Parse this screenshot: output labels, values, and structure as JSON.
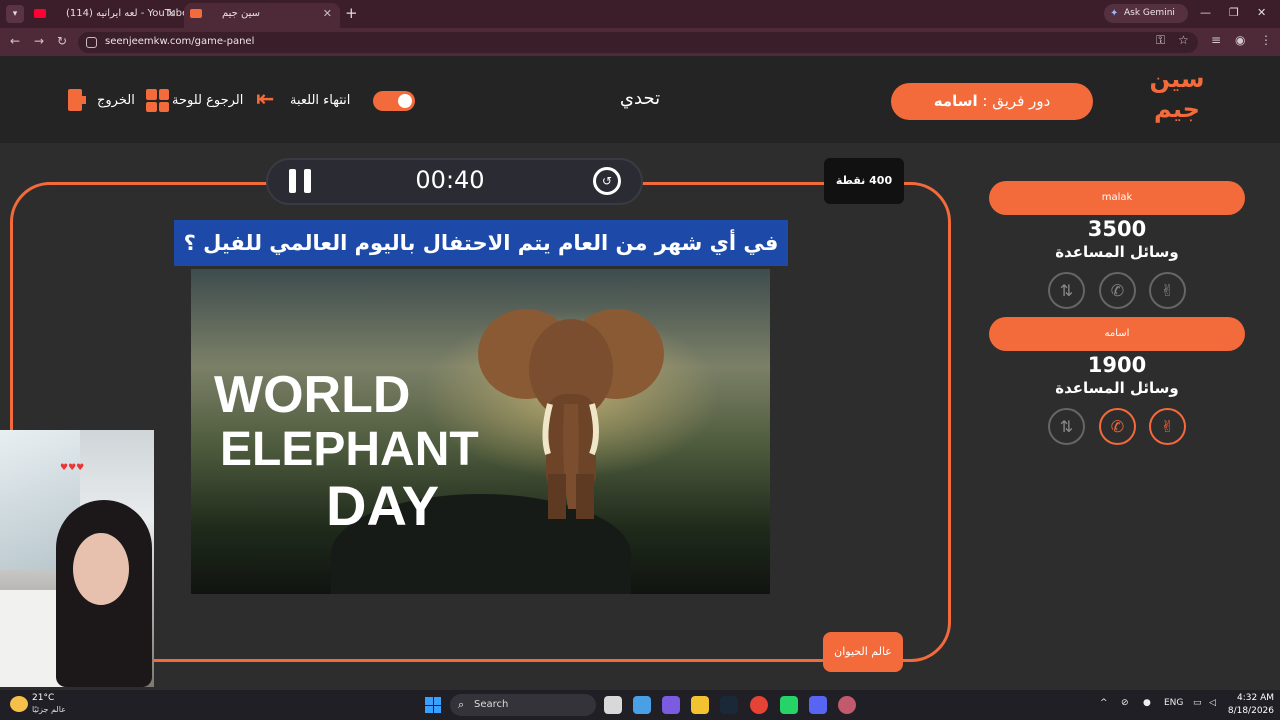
{
  "browser": {
    "tabs": [
      {
        "title": "(114) لعه ايرانيه - YouTube",
        "active": false
      },
      {
        "title": "سين جيم",
        "active": true
      }
    ],
    "new_tab_icon": "+",
    "ask_gemini": "Ask Gemini",
    "url": "seenjeemkw.com/game-panel"
  },
  "header": {
    "logo_text": "سين جيم",
    "turn_prefix": "دور فريق :",
    "turn_team": "اسامه",
    "mode": "تحدي",
    "end_game": "انتهاء اللعبة",
    "back_to_board": "الرجوع للوحة",
    "exit": "الخروج"
  },
  "question_panel": {
    "timer": "00:40",
    "points": "400 نقطة",
    "question": "في أي شهر من العام يتم الاحتفال باليوم العالمي للفيل ؟",
    "image_caption": [
      "WORLD",
      "ELEPHANT",
      "DAY"
    ],
    "category": "عالم الحيوان"
  },
  "teams": [
    {
      "name": "malak",
      "score": "3500",
      "helpers_label": "وسائل المساعدة",
      "aids_active": [
        false,
        false,
        false
      ]
    },
    {
      "name": "اسامه",
      "score": "1900",
      "helpers_label": "وسائل المساعدة",
      "aids_active": [
        false,
        true,
        true
      ]
    }
  ],
  "taskbar": {
    "temperature": "21°C",
    "weather_desc": "عالم جزئيًا",
    "search": "Search",
    "lang": "ENG",
    "time": "4:32 AM",
    "date": "8/18/2026"
  },
  "colors": {
    "accent": "#f36a3b",
    "question_bg": "#1d4aa8",
    "board_bg": "#2d2d2d"
  }
}
